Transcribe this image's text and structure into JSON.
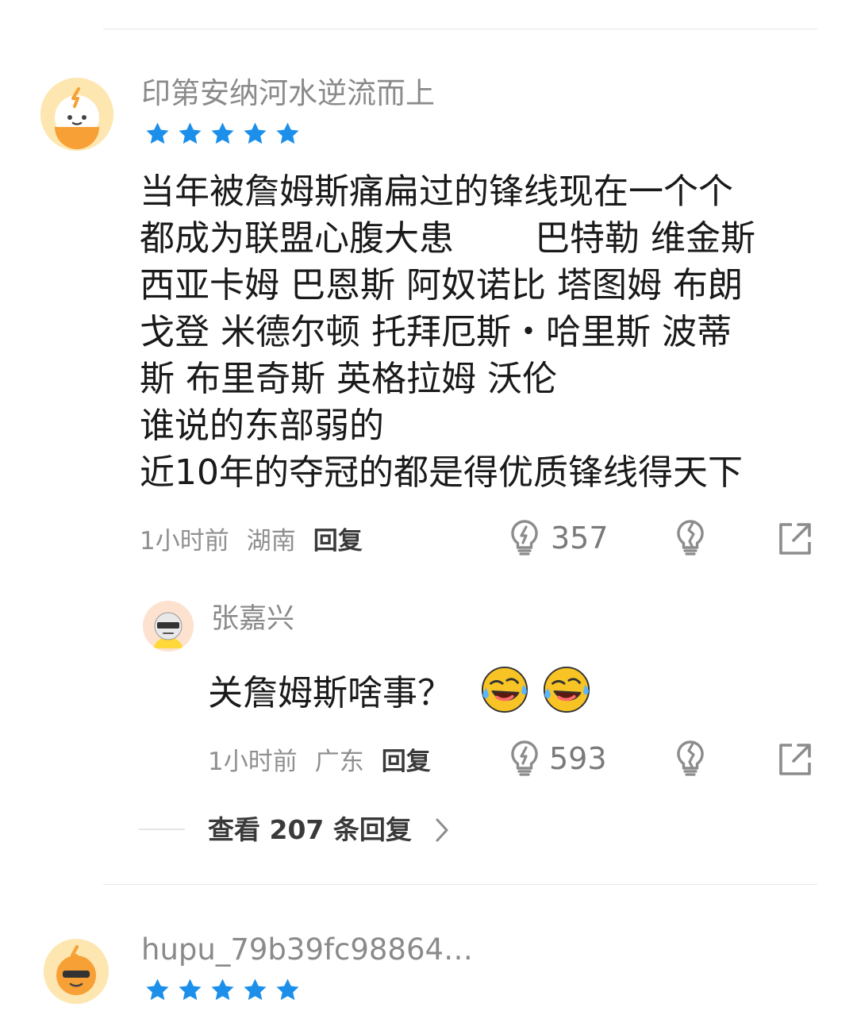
{
  "comment1": {
    "username": "印第安纳河水逆流而上",
    "rating": 5,
    "lines": [
      "当年被詹姆斯痛扁过的锋线现在一个个",
      "都成为联盟心腹大患　　 巴特勒 维金斯",
      "西亚卡姆 巴恩斯 阿奴诺比 塔图姆 布朗",
      "戈登 米德尔顿 托拜厄斯・哈里斯  波蒂",
      "斯 布里奇斯 英格拉姆 沃伦",
      "谁说的东部弱的",
      "近10年的夺冠的都是得优质锋线得天下"
    ],
    "time": "1小时前",
    "location": "湖南",
    "reply_label": "回复",
    "like_count": "357"
  },
  "reply1": {
    "username": "张嘉兴",
    "text": "关詹姆斯啥事？",
    "emojis": [
      "rofl-emoji",
      "rofl-emoji"
    ],
    "time": "1小时前",
    "location": "广东",
    "reply_label": "回复",
    "like_count": "593"
  },
  "view_more": {
    "label": "查看 207 条回复"
  },
  "comment2": {
    "username": "hupu_79b39fc98864…",
    "rating": 5
  },
  "colors": {
    "star": "#1b8fea",
    "username": "#8a8a8a",
    "icon": "#8c8c8c",
    "avatar_bg": "#fde6b0",
    "emoji": "#f7c325"
  },
  "icons": {
    "like": "light-bulb-icon",
    "dislike": "broken-light-bulb-icon",
    "share": "share-icon",
    "expand": "chevron-right-icon"
  }
}
